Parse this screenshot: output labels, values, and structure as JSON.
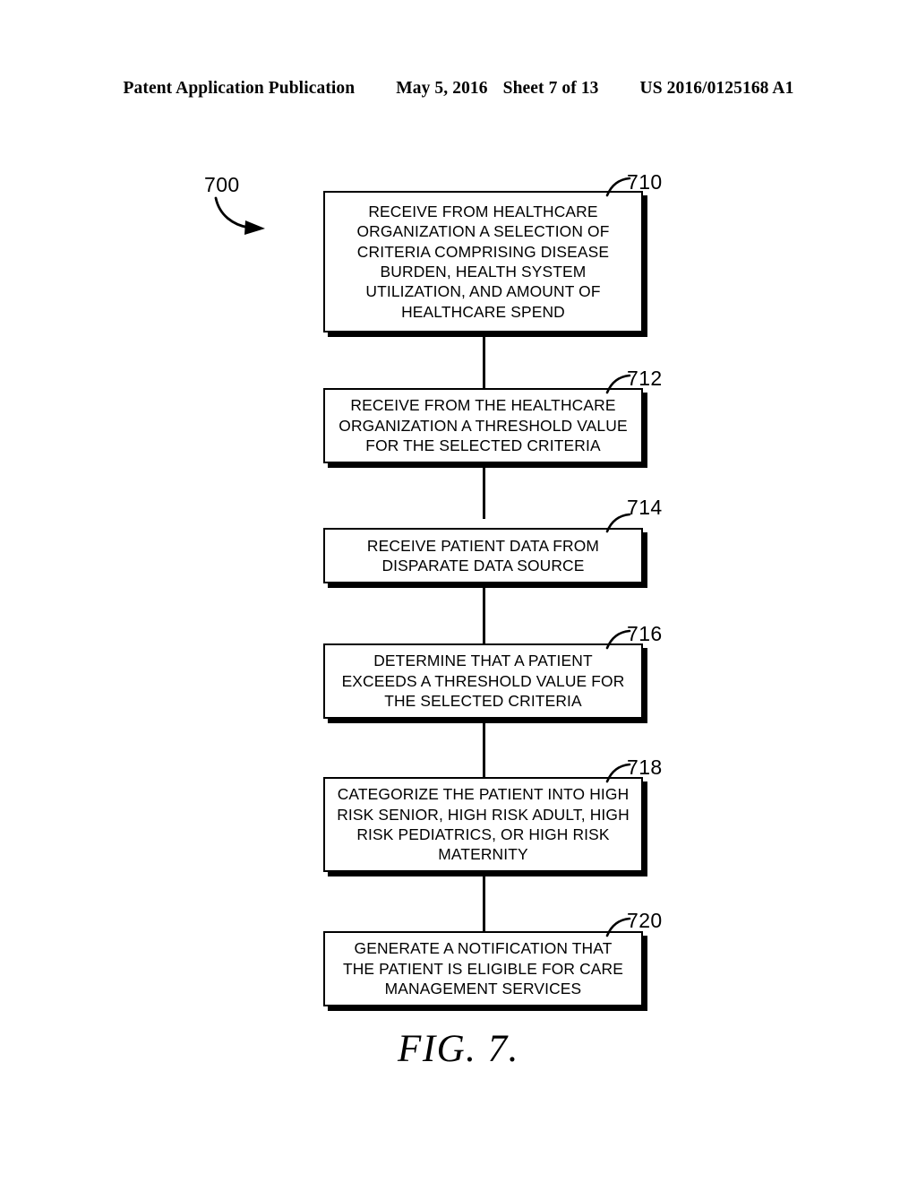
{
  "header": {
    "publication": "Patent Application Publication",
    "date": "May 5, 2016",
    "sheet": "Sheet 7 of 13",
    "patent_number": "US 2016/0125168 A1"
  },
  "figure": {
    "caption": "FIG. 7.",
    "diagram_label": "700"
  },
  "flowchart": {
    "nodes": [
      {
        "ref": "710",
        "text": "RECEIVE FROM HEALTHCARE\nORGANIZATION A SELECTION OF\nCRITERIA COMPRISING DISEASE\nBURDEN, HEALTH SYSTEM\nUTILIZATION, AND AMOUNT OF\nHEALTHCARE SPEND"
      },
      {
        "ref": "712",
        "text": "RECEIVE FROM THE HEALTHCARE\nORGANIZATION A THRESHOLD VALUE\nFOR THE SELECTED CRITERIA"
      },
      {
        "ref": "714",
        "text": "RECEIVE PATIENT DATA FROM\nDISPARATE DATA SOURCE"
      },
      {
        "ref": "716",
        "text": "DETERMINE THAT A PATIENT\nEXCEEDS A THRESHOLD VALUE FOR\nTHE SELECTED CRITERIA"
      },
      {
        "ref": "718",
        "text": "CATEGORIZE THE PATIENT INTO HIGH\nRISK SENIOR, HIGH RISK ADULT, HIGH\nRISK PEDIATRICS, OR HIGH RISK\nMATERNITY"
      },
      {
        "ref": "720",
        "text": "GENERATE A NOTIFICATION THAT\nTHE PATIENT IS ELIGIBLE FOR CARE\nMANAGEMENT SERVICES"
      }
    ]
  }
}
